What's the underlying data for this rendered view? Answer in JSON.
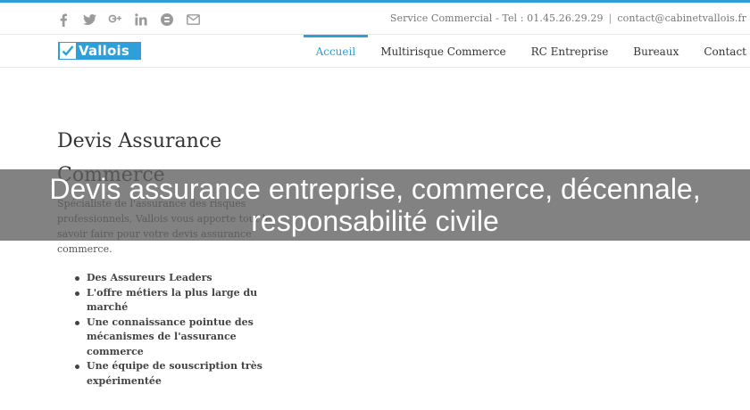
{
  "topbar": {
    "social_icons": [
      "facebook-icon",
      "twitter-icon",
      "google-plus-icon",
      "linkedin-icon",
      "blogger-icon",
      "email-icon"
    ],
    "phone_text": "Service Commercial - Tel : 01.45.26.29.29",
    "separator": "|",
    "email_text": "contact@cabinetvallois.fr"
  },
  "brand": {
    "logo_text": "Vallois",
    "accent_color": "#2e9fd8"
  },
  "nav": {
    "items": [
      {
        "label": "Accueil",
        "active": true
      },
      {
        "label": "Multirisque Commerce",
        "active": false
      },
      {
        "label": "RC Entreprise",
        "active": false
      },
      {
        "label": "Bureaux",
        "active": false
      },
      {
        "label": "Contact",
        "active": false
      }
    ]
  },
  "main": {
    "title": "Devis Assurance Commerce",
    "intro": "Spécialiste de l'assurance des risques professionnels, Vallois vous apporte tout le savoir faire pour votre devis assurance commerce.",
    "bullets": [
      "Des Assureurs Leaders",
      "L'offre métiers la plus large du marché",
      "Une connaissance pointue des mécanismes de l'assurance commerce",
      "Une équipe de souscription très expérimentée"
    ]
  },
  "overlay": {
    "caption": "Devis assurance entreprise, commerce, décennale, responsabilité civile"
  }
}
